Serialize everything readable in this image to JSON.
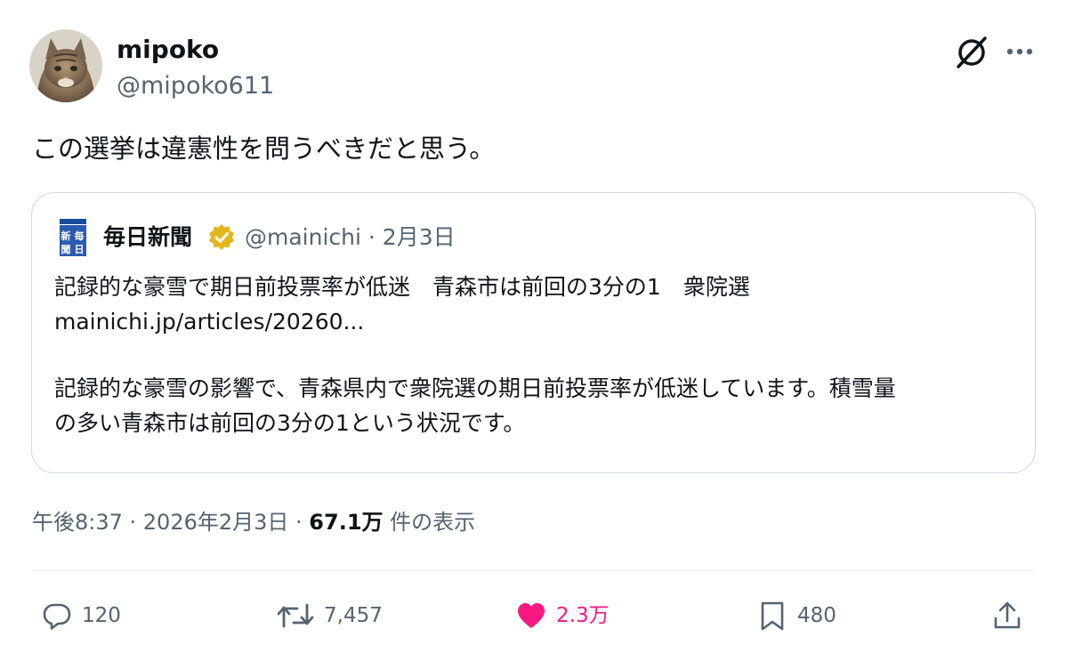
{
  "author": {
    "name": "mipoko",
    "handle": "@mipoko611"
  },
  "tweet": {
    "text": "この選挙は違憲性を問うべきだと思う。",
    "timestamp": "午後8:37 · 2026年2月3日 · ",
    "views_count": "67.1万",
    "views_label": " 件の表示"
  },
  "quote": {
    "logo_text": "新毎聞日",
    "name": "毎日新聞",
    "handle": "@mainichi",
    "date": "2月3日",
    "lines": [
      "記録的な豪雪で期日前投票率が低迷　青森市は前回の3分の1　衆院選",
      "mainichi.jp/articles/20260...",
      "",
      "記録的な豪雪の影響で、青森県内で衆院選の期日前投票率が低迷しています。積雪量",
      "の多い青森市は前回の3分の1という状況です。"
    ]
  },
  "actions": {
    "reply": {
      "count": "120",
      "icon": "reply-icon"
    },
    "repost": {
      "count": "7,457",
      "icon": "repost-icon"
    },
    "like": {
      "count": "2.3万",
      "icon": "heart-icon",
      "color": "#f91880"
    },
    "bookmark": {
      "count": "480",
      "icon": "bookmark-icon"
    },
    "share": {
      "icon": "share-icon"
    }
  },
  "colors": {
    "text": "#0f1419",
    "secondary": "#536471",
    "border": "#cfd9de",
    "like": "#f91880",
    "verified": "#e2b719"
  }
}
